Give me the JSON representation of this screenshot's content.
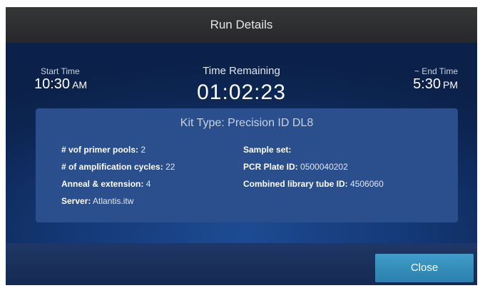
{
  "window": {
    "title": "Run Details"
  },
  "times": {
    "start": {
      "label": "Start Time",
      "value": "10:30",
      "unit": "AM"
    },
    "remaining": {
      "label": "Time Remaining",
      "value": "01:02:23"
    },
    "end": {
      "label": "~ End Time",
      "value": "5:30",
      "unit": "PM"
    }
  },
  "details": {
    "kit_type": "Kit Type: Precision ID DL8",
    "left": [
      {
        "label": "# vof primer pools:",
        "value": "2"
      },
      {
        "label": "# of amplification cycles:",
        "value": "22"
      },
      {
        "label": "Anneal & extension:",
        "value": "4"
      },
      {
        "label": "Server:",
        "value": "Atlantis.itw"
      }
    ],
    "right": [
      {
        "label": "Sample set:",
        "value": ""
      },
      {
        "label": "PCR Plate ID:",
        "value": "0500040202"
      },
      {
        "label": "Combined library tube ID:",
        "value": "4506060"
      }
    ]
  },
  "footer": {
    "close_label": "Close"
  }
}
